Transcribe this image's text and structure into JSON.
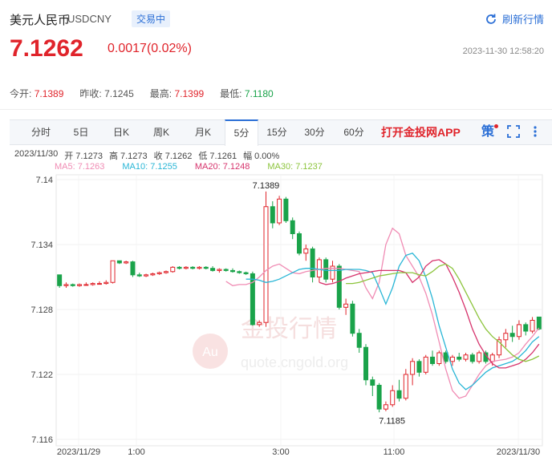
{
  "header": {
    "title": "美元人民币",
    "symbol": "USDCNY",
    "status": "交易中",
    "refresh_label": "刷新行情",
    "price": "7.1262",
    "change": "0.0017(0.02%)",
    "timestamp": "2023-11-30 12:58:20"
  },
  "stats": [
    {
      "label": "今开:",
      "value": "7.1389",
      "tone": "red"
    },
    {
      "label": "昨收:",
      "value": "7.1245",
      "tone": "plain"
    },
    {
      "label": "最高:",
      "value": "7.1399",
      "tone": "red"
    },
    {
      "label": "最低:",
      "value": "7.1180",
      "tone": "green"
    }
  ],
  "tabs": [
    "分时",
    "5日",
    "日K",
    "周K",
    "月K",
    "5分",
    "15分",
    "30分",
    "60分"
  ],
  "active_tab": "5分",
  "promo": "打开金投网APP",
  "tools": {
    "strategy_icon": "策",
    "fullscreen_icon": "fullscreen-icon",
    "more_icon": "more-vertical-icon"
  },
  "ohlc_info": {
    "date": "2023/11/30",
    "open": "开 7.1273",
    "high": "高 7.1273",
    "close": "收 7.1262",
    "low": "低 7.1261",
    "amplitude": "幅 0.00%"
  },
  "ma_legend": [
    {
      "label": "MA5: 7.1263",
      "color": "#f08cb4"
    },
    {
      "label": "MA10: 7.1255",
      "color": "#29b6d6"
    },
    {
      "label": "MA20: 7.1248",
      "color": "#d6336c"
    },
    {
      "label": "MA30: 7.1237",
      "color": "#8cc43c"
    }
  ],
  "watermark": {
    "main": "金投行情",
    "sub": "quote.cngold.org",
    "badge": "Au"
  },
  "chart_data": {
    "type": "candlestick",
    "ylim": [
      7.116,
      7.14
    ],
    "y_ticks": [
      "7.14",
      "7.134",
      "7.128",
      "7.122",
      "7.116"
    ],
    "x_ticks": [
      "2023/11/29",
      "1:00",
      "3:00",
      "11:00",
      "2023/11/30"
    ],
    "annotations": {
      "high": "7.1389",
      "low": "7.1185"
    },
    "up_color": "#e0242b",
    "down_color": "#1aa34a",
    "candles": [
      {
        "o": 7.1312,
        "h": 7.1312,
        "l": 7.13,
        "c": 7.1302
      },
      {
        "o": 7.1302,
        "h": 7.1305,
        "l": 7.13,
        "c": 7.1303
      },
      {
        "o": 7.1303,
        "h": 7.1304,
        "l": 7.1301,
        "c": 7.1302
      },
      {
        "o": 7.1302,
        "h": 7.1304,
        "l": 7.1301,
        "c": 7.1303
      },
      {
        "o": 7.1303,
        "h": 7.1305,
        "l": 7.1302,
        "c": 7.1303
      },
      {
        "o": 7.1303,
        "h": 7.1305,
        "l": 7.1302,
        "c": 7.1304
      },
      {
        "o": 7.1304,
        "h": 7.1306,
        "l": 7.1303,
        "c": 7.1304
      },
      {
        "o": 7.1304,
        "h": 7.1307,
        "l": 7.1303,
        "c": 7.1305
      },
      {
        "o": 7.1305,
        "h": 7.1325,
        "l": 7.1304,
        "c": 7.1325
      },
      {
        "o": 7.1325,
        "h": 7.1325,
        "l": 7.1322,
        "c": 7.1323
      },
      {
        "o": 7.1323,
        "h": 7.1325,
        "l": 7.1322,
        "c": 7.1324
      },
      {
        "o": 7.1324,
        "h": 7.1325,
        "l": 7.131,
        "c": 7.1312
      },
      {
        "o": 7.1312,
        "h": 7.1314,
        "l": 7.131,
        "c": 7.1311
      },
      {
        "o": 7.1311,
        "h": 7.1313,
        "l": 7.131,
        "c": 7.1312
      },
      {
        "o": 7.1312,
        "h": 7.1314,
        "l": 7.1311,
        "c": 7.1313
      },
      {
        "o": 7.1313,
        "h": 7.1315,
        "l": 7.1312,
        "c": 7.1314
      },
      {
        "o": 7.1314,
        "h": 7.1316,
        "l": 7.1313,
        "c": 7.1315
      },
      {
        "o": 7.1315,
        "h": 7.132,
        "l": 7.1314,
        "c": 7.1319
      },
      {
        "o": 7.1319,
        "h": 7.132,
        "l": 7.1317,
        "c": 7.1318
      },
      {
        "o": 7.1318,
        "h": 7.132,
        "l": 7.1317,
        "c": 7.1319
      },
      {
        "o": 7.1319,
        "h": 7.132,
        "l": 7.1317,
        "c": 7.1318
      },
      {
        "o": 7.1318,
        "h": 7.132,
        "l": 7.1317,
        "c": 7.1319
      },
      {
        "o": 7.1319,
        "h": 7.132,
        "l": 7.1317,
        "c": 7.1318
      },
      {
        "o": 7.1318,
        "h": 7.132,
        "l": 7.1315,
        "c": 7.1316
      },
      {
        "o": 7.1316,
        "h": 7.1318,
        "l": 7.1314,
        "c": 7.1317
      },
      {
        "o": 7.1317,
        "h": 7.1318,
        "l": 7.1315,
        "c": 7.1316
      },
      {
        "o": 7.1316,
        "h": 7.1318,
        "l": 7.1314,
        "c": 7.1315
      },
      {
        "o": 7.1315,
        "h": 7.1316,
        "l": 7.1313,
        "c": 7.1314
      },
      {
        "o": 7.1314,
        "h": 7.1315,
        "l": 7.1312,
        "c": 7.1313
      },
      {
        "o": 7.1313,
        "h": 7.1315,
        "l": 7.1265,
        "c": 7.1266
      },
      {
        "o": 7.1266,
        "h": 7.127,
        "l": 7.1264,
        "c": 7.1268
      },
      {
        "o": 7.1268,
        "h": 7.1389,
        "l": 7.1264,
        "c": 7.1375
      },
      {
        "o": 7.1375,
        "h": 7.138,
        "l": 7.1355,
        "c": 7.136
      },
      {
        "o": 7.136,
        "h": 7.1385,
        "l": 7.1358,
        "c": 7.1382
      },
      {
        "o": 7.1382,
        "h": 7.1384,
        "l": 7.136,
        "c": 7.1362
      },
      {
        "o": 7.1362,
        "h": 7.1365,
        "l": 7.1345,
        "c": 7.135
      },
      {
        "o": 7.135,
        "h": 7.1352,
        "l": 7.133,
        "c": 7.1332
      },
      {
        "o": 7.1332,
        "h": 7.134,
        "l": 7.1325,
        "c": 7.1336
      },
      {
        "o": 7.1336,
        "h": 7.1338,
        "l": 7.1305,
        "c": 7.131
      },
      {
        "o": 7.131,
        "h": 7.1328,
        "l": 7.1305,
        "c": 7.1326
      },
      {
        "o": 7.1326,
        "h": 7.1328,
        "l": 7.1305,
        "c": 7.1308
      },
      {
        "o": 7.1308,
        "h": 7.1325,
        "l": 7.1305,
        "c": 7.132
      },
      {
        "o": 7.132,
        "h": 7.1322,
        "l": 7.128,
        "c": 7.1282
      },
      {
        "o": 7.1282,
        "h": 7.129,
        "l": 7.1275,
        "c": 7.1285
      },
      {
        "o": 7.1285,
        "h": 7.1288,
        "l": 7.1255,
        "c": 7.1258
      },
      {
        "o": 7.1258,
        "h": 7.1262,
        "l": 7.124,
        "c": 7.1245
      },
      {
        "o": 7.1245,
        "h": 7.1248,
        "l": 7.121,
        "c": 7.1215
      },
      {
        "o": 7.1215,
        "h": 7.1218,
        "l": 7.12,
        "c": 7.121
      },
      {
        "o": 7.121,
        "h": 7.1212,
        "l": 7.1185,
        "c": 7.1188
      },
      {
        "o": 7.1188,
        "h": 7.1195,
        "l": 7.1186,
        "c": 7.1192
      },
      {
        "o": 7.1192,
        "h": 7.121,
        "l": 7.119,
        "c": 7.1205
      },
      {
        "o": 7.1205,
        "h": 7.1215,
        "l": 7.1195,
        "c": 7.1198
      },
      {
        "o": 7.1198,
        "h": 7.1225,
        "l": 7.1196,
        "c": 7.122
      },
      {
        "o": 7.122,
        "h": 7.1235,
        "l": 7.121,
        "c": 7.1232
      },
      {
        "o": 7.1232,
        "h": 7.1234,
        "l": 7.1218,
        "c": 7.1222
      },
      {
        "o": 7.1222,
        "h": 7.1238,
        "l": 7.122,
        "c": 7.1236
      },
      {
        "o": 7.1236,
        "h": 7.1242,
        "l": 7.1228,
        "c": 7.123
      },
      {
        "o": 7.123,
        "h": 7.1242,
        "l": 7.1228,
        "c": 7.124
      },
      {
        "o": 7.124,
        "h": 7.1242,
        "l": 7.123,
        "c": 7.1232
      },
      {
        "o": 7.1232,
        "h": 7.1238,
        "l": 7.1228,
        "c": 7.1236
      },
      {
        "o": 7.1236,
        "h": 7.124,
        "l": 7.1232,
        "c": 7.1234
      },
      {
        "o": 7.1234,
        "h": 7.124,
        "l": 7.1232,
        "c": 7.1238
      },
      {
        "o": 7.1238,
        "h": 7.124,
        "l": 7.123,
        "c": 7.1232
      },
      {
        "o": 7.1232,
        "h": 7.1242,
        "l": 7.123,
        "c": 7.124
      },
      {
        "o": 7.124,
        "h": 7.1242,
        "l": 7.123,
        "c": 7.1232
      },
      {
        "o": 7.1232,
        "h": 7.124,
        "l": 7.1228,
        "c": 7.1238
      },
      {
        "o": 7.1238,
        "h": 7.1255,
        "l": 7.1235,
        "c": 7.1252
      },
      {
        "o": 7.1252,
        "h": 7.1262,
        "l": 7.1245,
        "c": 7.1258
      },
      {
        "o": 7.1258,
        "h": 7.1265,
        "l": 7.125,
        "c": 7.1255
      },
      {
        "o": 7.1255,
        "h": 7.127,
        "l": 7.1252,
        "c": 7.1266
      },
      {
        "o": 7.1266,
        "h": 7.1268,
        "l": 7.1256,
        "c": 7.126
      },
      {
        "o": 7.126,
        "h": 7.1273,
        "l": 7.1258,
        "c": 7.127
      },
      {
        "o": 7.1273,
        "h": 7.1273,
        "l": 7.1261,
        "c": 7.1262
      }
    ],
    "ma_lines": [
      {
        "name": "MA5",
        "color": "#f08cb4",
        "values": [
          7.1306,
          7.1302,
          7.1303,
          7.1303,
          7.1305,
          7.131,
          7.1316,
          7.132,
          7.1322,
          7.1318,
          7.1314,
          7.1313,
          7.1315,
          7.1316,
          7.1317,
          7.1318,
          7.1318,
          7.1318,
          7.1317,
          7.1316,
          7.1315,
          7.13,
          7.129,
          7.1305,
          7.134,
          7.1355,
          7.135,
          7.133,
          7.132,
          7.131,
          7.1295,
          7.1275,
          7.125,
          7.1225,
          7.1205,
          7.1198,
          7.12,
          7.121,
          7.122,
          7.1228,
          7.1232,
          7.1233,
          7.1234,
          7.1236,
          7.124,
          7.1248,
          7.1255,
          7.1263
        ]
      },
      {
        "name": "MA10",
        "color": "#29b6d6",
        "values": [
          7.1308,
          7.1308,
          7.1307,
          7.1305,
          7.1306,
          7.1308,
          7.1311,
          7.1314,
          7.1317,
          7.1318,
          7.1318,
          7.1317,
          7.1316,
          7.1316,
          7.1316,
          7.1317,
          7.1317,
          7.1317,
          7.1316,
          7.1314,
          7.13,
          7.1285,
          7.13,
          7.132,
          7.133,
          7.1332,
          7.1325,
          7.131,
          7.129,
          7.1265,
          7.1245,
          7.1225,
          7.1212,
          7.1206,
          7.121,
          7.1216,
          7.1222,
          7.1226,
          7.1228,
          7.123,
          7.1232,
          7.1236,
          7.1242,
          7.125,
          7.1255
        ]
      },
      {
        "name": "MA20",
        "color": "#d6336c",
        "values": [
          7.1305,
          7.1303,
          7.1304,
          7.1306,
          7.1309,
          7.1311,
          7.1313,
          7.1314,
          7.1315,
          7.1316,
          7.1316,
          7.1316,
          7.1316,
          7.1314,
          7.1305,
          7.131,
          7.132,
          7.1325,
          7.1326,
          7.1322,
          7.131,
          7.1296,
          7.128,
          7.1262,
          7.1248,
          7.1238,
          7.123,
          7.1226,
          7.1226,
          7.1228,
          7.123,
          7.1234,
          7.124,
          7.1248
        ]
      },
      {
        "name": "MA30",
        "color": "#8cc43c",
        "values": [
          7.1304,
          7.1304,
          7.1305,
          7.1307,
          7.1309,
          7.1311,
          7.1312,
          7.1313,
          7.1314,
          7.1314,
          7.1314,
          7.1312,
          7.1311,
          7.1315,
          7.132,
          7.1322,
          7.1318,
          7.1308,
          7.1296,
          7.1284,
          7.1272,
          7.1262,
          7.1255,
          7.125,
          7.1244,
          7.1238,
          7.1234,
          7.1232,
          7.1234,
          7.1237
        ]
      }
    ]
  }
}
